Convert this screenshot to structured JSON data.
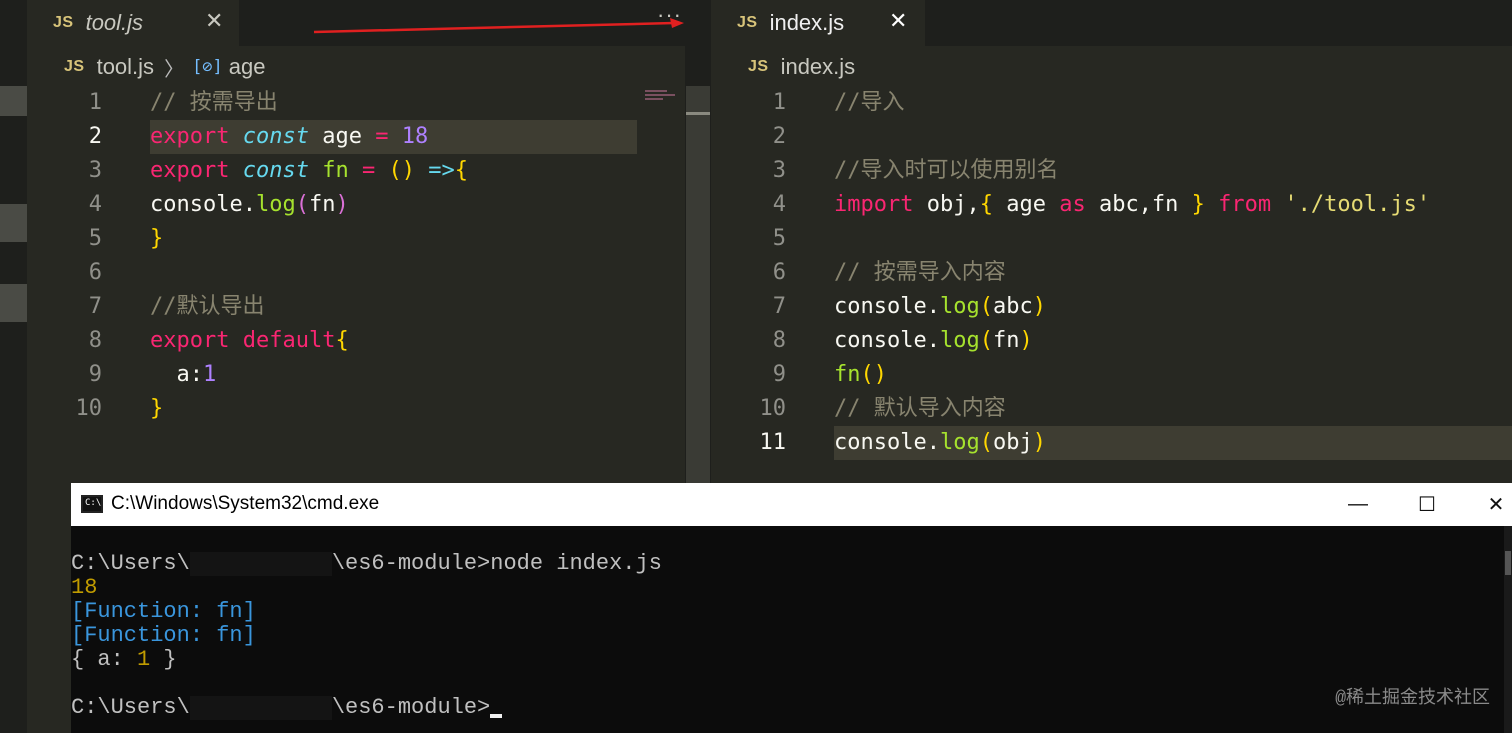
{
  "left_editor": {
    "tab": {
      "badge": "JS",
      "label": "tool.js",
      "close": "✕"
    },
    "more": "···",
    "breadcrumb": {
      "badge": "JS",
      "file": "tool.js",
      "symbol_icon": "[⊘]",
      "symbol": "age"
    },
    "lines": [
      {
        "no": "1",
        "tokens": [
          [
            "c",
            "// 按需导出"
          ]
        ]
      },
      {
        "no": "2",
        "active": true,
        "tokens": [
          [
            "k",
            "export"
          ],
          [
            "",
            " "
          ],
          [
            "s",
            "const"
          ],
          [
            "",
            " age "
          ],
          [
            "k",
            "="
          ],
          [
            "",
            " "
          ],
          [
            "n",
            "18"
          ]
        ]
      },
      {
        "no": "3",
        "tokens": [
          [
            "k",
            "export"
          ],
          [
            "",
            " "
          ],
          [
            "s",
            "const"
          ],
          [
            "",
            " "
          ],
          [
            "f",
            "fn"
          ],
          [
            "",
            " "
          ],
          [
            "k",
            "="
          ],
          [
            "",
            " "
          ],
          [
            "b1",
            "()"
          ],
          [
            "",
            " "
          ],
          [
            "s",
            "=>"
          ],
          [
            "b1",
            "{"
          ]
        ]
      },
      {
        "no": "4",
        "tokens": [
          [
            "",
            "console."
          ],
          [
            "f",
            "log"
          ],
          [
            "b2",
            "("
          ],
          [
            "",
            "fn"
          ],
          [
            "b2",
            ")"
          ]
        ]
      },
      {
        "no": "5",
        "tokens": [
          [
            "b1",
            "}"
          ]
        ]
      },
      {
        "no": "6",
        "tokens": []
      },
      {
        "no": "7",
        "tokens": [
          [
            "c",
            "//默认导出"
          ]
        ]
      },
      {
        "no": "8",
        "tokens": [
          [
            "k",
            "export"
          ],
          [
            "",
            " "
          ],
          [
            "k",
            "default"
          ],
          [
            "b1",
            "{"
          ]
        ]
      },
      {
        "no": "9",
        "tokens": [
          [
            "",
            "  a:"
          ],
          [
            "n",
            "1"
          ]
        ]
      },
      {
        "no": "10",
        "tokens": [
          [
            "b1",
            "}"
          ]
        ]
      }
    ]
  },
  "right_editor": {
    "tab": {
      "badge": "JS",
      "label": "index.js",
      "close": "✕"
    },
    "breadcrumb": {
      "badge": "JS",
      "file": "index.js"
    },
    "lines": [
      {
        "no": "1",
        "tokens": [
          [
            "c",
            "//导入"
          ]
        ]
      },
      {
        "no": "2",
        "tokens": []
      },
      {
        "no": "3",
        "tokens": [
          [
            "c",
            "//导入时可以使用别名"
          ]
        ]
      },
      {
        "no": "4",
        "tokens": [
          [
            "k",
            "import"
          ],
          [
            "",
            " obj,"
          ],
          [
            "b1",
            "{"
          ],
          [
            "",
            " age "
          ],
          [
            "k",
            "as"
          ],
          [
            "",
            " abc,fn "
          ],
          [
            "b1",
            "}"
          ],
          [
            "",
            " "
          ],
          [
            "k",
            "from"
          ],
          [
            "",
            " "
          ],
          [
            "str",
            "'./tool.js'"
          ]
        ]
      },
      {
        "no": "5",
        "tokens": []
      },
      {
        "no": "6",
        "tokens": [
          [
            "c",
            "// 按需导入内容"
          ]
        ]
      },
      {
        "no": "7",
        "tokens": [
          [
            "",
            "console."
          ],
          [
            "f",
            "log"
          ],
          [
            "b1",
            "("
          ],
          [
            "",
            "abc"
          ],
          [
            "b1",
            ")"
          ]
        ]
      },
      {
        "no": "8",
        "tokens": [
          [
            "",
            "console."
          ],
          [
            "f",
            "log"
          ],
          [
            "b1",
            "("
          ],
          [
            "",
            "fn"
          ],
          [
            "b1",
            ")"
          ]
        ]
      },
      {
        "no": "9",
        "tokens": [
          [
            "f",
            "fn"
          ],
          [
            "b1",
            "()"
          ]
        ]
      },
      {
        "no": "10",
        "tokens": [
          [
            "c",
            "// 默认导入内容"
          ]
        ]
      },
      {
        "no": "11",
        "active": true,
        "tokens": [
          [
            "",
            "console."
          ],
          [
            "f",
            "log"
          ],
          [
            "b1",
            "("
          ],
          [
            "",
            "obj"
          ],
          [
            "b1",
            ")"
          ]
        ]
      }
    ]
  },
  "cmd": {
    "title": "C:\\Windows\\System32\\cmd.exe",
    "icon_text": "C:\\",
    "minimize": "—",
    "maximize": "☐",
    "close": "✕",
    "prompt_prefix": "C:\\Users\\",
    "prompt_suffix": "\\es6-module>",
    "command": "node index.js",
    "output": {
      "age": "18",
      "fn1": "[Function: fn]",
      "fn2": "[Function: fn]",
      "obj_open": "{ a: ",
      "obj_val": "1",
      "obj_close": " }"
    }
  },
  "watermark": "@稀土掘金技术社区",
  "colors": {
    "keyword": "#f92672",
    "storage": "#66d9ef",
    "number": "#ae81ff",
    "comment": "#88846f",
    "function": "#a6e22e",
    "string": "#e6db74",
    "bracket": "#ffd700",
    "arrow": "#e02020"
  }
}
